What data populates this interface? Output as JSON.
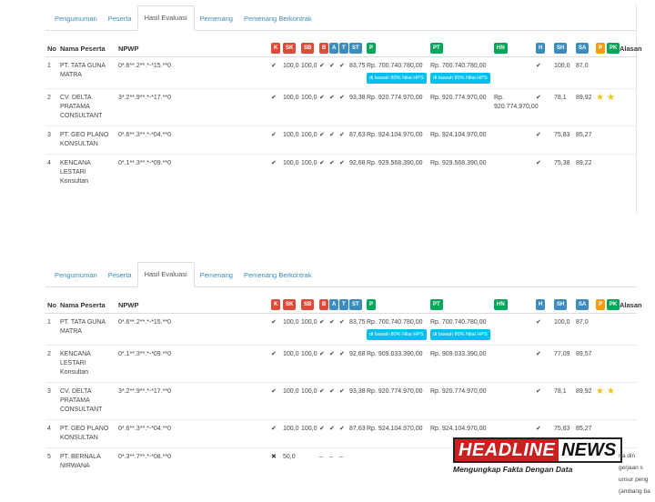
{
  "legend_labels": [
    "K",
    "SK",
    "SB",
    "B",
    "A",
    "T",
    "ST",
    "P",
    "PT",
    "HN",
    "H",
    "SH",
    "SA",
    "P",
    "PK"
  ],
  "tabs": [
    "Pengumuman",
    "Peserta",
    "Hasil Evaluasi",
    "Pemenang",
    "Pemenang Berkontrak"
  ],
  "columns": {
    "no": "No",
    "nama": "Nama Peserta",
    "npwp": "NPWP",
    "alasan": "Alasan"
  },
  "note_text": "di bawah 80% Nilai HPS",
  "panel1": {
    "rows": [
      {
        "no": "1",
        "nama": "PT. TATA GUNA MATRA",
        "npwp": "0*.6**.2**.*-*15.**0",
        "k": "✔",
        "sk": "100,0",
        "sb": "100,0",
        "b": "✔",
        "a": "✔",
        "t": "✔",
        "st": "83,75",
        "p": "Rp. 700.740.780,00",
        "pt": "Rp. 700.740.780,00",
        "hn": "",
        "h": "✔",
        "sh": "100,0",
        "sa": "87,0",
        "star": false
      },
      {
        "no": "2",
        "nama": "CV. DELTA PRATAMA CONSULTANT",
        "npwp": "3*.2**.9**.*-*17.**0",
        "k": "✔",
        "sk": "100,0",
        "sb": "100,0",
        "b": "✔",
        "a": "✔",
        "t": "✔",
        "st": "93,38",
        "p": "Rp. 920.774.970,00",
        "pt": "Rp. 920.774.970,00",
        "hn": "Rp. 920.774.970,00",
        "h": "✔",
        "sh": "78,1",
        "sa": "89,92",
        "star": true
      },
      {
        "no": "3",
        "nama": "PT. GEO PLANO KONSULTAN",
        "npwp": "0*.6**.3**.*-*04.**0",
        "k": "✔",
        "sk": "100,0",
        "sb": "100,0",
        "b": "✔",
        "a": "✔",
        "t": "✔",
        "st": "87,63",
        "p": "Rp. 924.104.970,00",
        "pt": "Rp. 924.104.970,00",
        "hn": "",
        "h": "✔",
        "sh": "75,83",
        "sa": "85,27",
        "star": false
      },
      {
        "no": "4",
        "nama": "KENCANA LESTARI Konsultan",
        "npwp": "0*.1**.3**.*-*09.**0",
        "k": "✔",
        "sk": "100,0",
        "sb": "100,0",
        "b": "✔",
        "a": "✔",
        "t": "✔",
        "st": "92,68",
        "p": "Rp. 929.568.390,00",
        "pt": "Rp. 929.568.390,00",
        "hn": "",
        "h": "✔",
        "sh": "75,38",
        "sa": "89,22",
        "star": false
      }
    ]
  },
  "panel2": {
    "rows": [
      {
        "no": "1",
        "nama": "PT. TATA GUNA MATRA",
        "npwp": "0*.6**.2**.*-*15.**0",
        "k": "✔",
        "sk": "100,0",
        "sb": "100,0",
        "b": "✔",
        "a": "✔",
        "t": "✔",
        "st": "83,75",
        "p": "Rp. 700.740.780,00",
        "pt": "Rp. 700.740.780,00",
        "hn": "",
        "h": "✔",
        "sh": "100,0",
        "sa": "87,0",
        "star": false
      },
      {
        "no": "2",
        "nama": "KENCANA LESTARI Konsultan",
        "npwp": "0*.1**.3**.*-*09.**0",
        "k": "✔",
        "sk": "100,0",
        "sb": "100,0",
        "b": "✔",
        "a": "✔",
        "t": "✔",
        "st": "92,68",
        "p": "Rp. 909.033.390,00",
        "pt": "Rp. 909.033.390,00",
        "hn": "",
        "h": "✔",
        "sh": "77,09",
        "sa": "89,57",
        "star": false
      },
      {
        "no": "3",
        "nama": "CV. DELTA PRATAMA CONSULTANT",
        "npwp": "3*.2**.9**.*-*17.**0",
        "k": "✔",
        "sk": "100,0",
        "sb": "100,0",
        "b": "✔",
        "a": "✔",
        "t": "✔",
        "st": "93,38",
        "p": "Rp. 920.774.970,00",
        "pt": "Rp. 920.774.970,00",
        "hn": "",
        "h": "✔",
        "sh": "78,1",
        "sa": "89,92",
        "star": true
      },
      {
        "no": "4",
        "nama": "PT. GEO PLANO KONSULTAN",
        "npwp": "0*.6**.3**.*-*04.**0",
        "k": "✔",
        "sk": "100,0",
        "sb": "100,0",
        "b": "✔",
        "a": "✔",
        "t": "✔",
        "st": "87,63",
        "p": "Rp. 924.104.970,00",
        "pt": "Rp. 924.104.970,00",
        "hn": "",
        "h": "✔",
        "sh": "75,83",
        "sa": "85,27",
        "star": false
      },
      {
        "no": "5",
        "nama": "PT. BERNALA NIRWANA",
        "npwp": "0*.3**.7**.*-*08.**0",
        "k": "✖",
        "sk": "50,0",
        "sb": "",
        "b": "–",
        "a": "–",
        "t": "–",
        "st": "",
        "p": "",
        "pt": "",
        "hn": "",
        "h": "",
        "sh": "",
        "sa": "",
        "star": false
      }
    ]
  },
  "logo": {
    "word1": "HEADLINE",
    "word2": "NEWS",
    "tagline": "Mengungkap Fakta Dengan Data"
  },
  "side_text": [
    "rta din",
    "gerjaan s",
    "unsur peng",
    "(ambang ba"
  ],
  "colors": {
    "link": "#3c8dbc",
    "red_label": "#dd4b39",
    "blue_label": "#3c8dbc",
    "green_label": "#00a65a",
    "teal_label": "#00c0ef",
    "orange_label": "#f39c12",
    "logo_red": "#cc1f1f"
  }
}
